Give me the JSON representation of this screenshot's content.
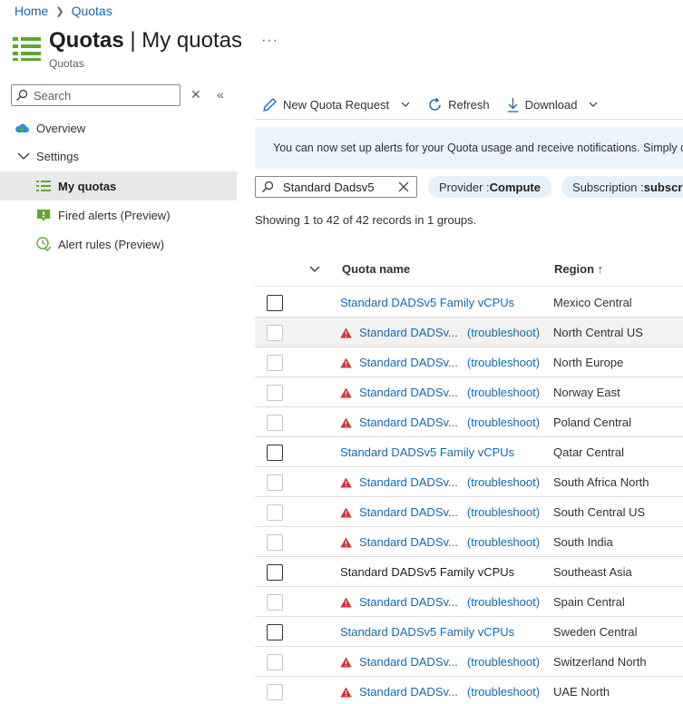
{
  "breadcrumb": {
    "home": "Home",
    "current": "Quotas"
  },
  "header": {
    "title_bold": "Quotas",
    "title_rest": " | My quotas",
    "subtitle": "Quotas",
    "more": "···"
  },
  "sidebar": {
    "search_placeholder": "Search",
    "items": [
      {
        "label": "Overview",
        "icon": "cloud-icon"
      },
      {
        "label": "Settings",
        "icon": "chevron-down-icon"
      },
      {
        "label": "My quotas",
        "icon": "list-icon",
        "selected": true
      },
      {
        "label": "Fired alerts (Preview)",
        "icon": "alert-book-icon"
      },
      {
        "label": "Alert rules (Preview)",
        "icon": "clock-check-icon"
      }
    ]
  },
  "toolbar": {
    "new_request": "New Quota Request",
    "refresh": "Refresh",
    "download": "Download"
  },
  "info_bar": {
    "text": "You can now set up alerts for your Quota usage and receive notifications. Simply cl"
  },
  "filter": {
    "search_value": "Standard Dadsv5",
    "provider_key": "Provider : ",
    "provider_value": "Compute",
    "subscription_key": "Subscription : ",
    "subscription_value": "subscri"
  },
  "records_text": "Showing 1 to 42 of 42 records in 1 groups.",
  "table": {
    "col_quota": "Quota name",
    "col_region": "Region ↑",
    "rows": [
      {
        "name": "Standard DADSv5 Family vCPUs",
        "warn": false,
        "link": true,
        "region": "Mexico Central",
        "hl": false
      },
      {
        "name": "Standard DADSv...",
        "warn": true,
        "link": true,
        "troubleshoot": "(troubleshoot)",
        "region": "North Central US",
        "hl": true
      },
      {
        "name": "Standard DADSv...",
        "warn": true,
        "link": true,
        "troubleshoot": "(troubleshoot)",
        "region": "North Europe",
        "hl": false
      },
      {
        "name": "Standard DADSv...",
        "warn": true,
        "link": true,
        "troubleshoot": "(troubleshoot)",
        "region": "Norway East",
        "hl": false
      },
      {
        "name": "Standard DADSv...",
        "warn": true,
        "link": true,
        "troubleshoot": "(troubleshoot)",
        "region": "Poland Central",
        "hl": false
      },
      {
        "name": "Standard DADSv5 Family vCPUs",
        "warn": false,
        "link": true,
        "region": "Qatar Central",
        "hl": false
      },
      {
        "name": "Standard DADSv...",
        "warn": true,
        "link": true,
        "troubleshoot": "(troubleshoot)",
        "region": "South Africa North",
        "hl": false
      },
      {
        "name": "Standard DADSv...",
        "warn": true,
        "link": true,
        "troubleshoot": "(troubleshoot)",
        "region": "South Central US",
        "hl": false
      },
      {
        "name": "Standard DADSv...",
        "warn": true,
        "link": true,
        "troubleshoot": "(troubleshoot)",
        "region": "South India",
        "hl": false
      },
      {
        "name": "Standard DADSv5 Family vCPUs",
        "warn": false,
        "link": false,
        "region": "Southeast Asia",
        "hl": false
      },
      {
        "name": "Standard DADSv...",
        "warn": true,
        "link": true,
        "troubleshoot": "(troubleshoot)",
        "region": "Spain Central",
        "hl": false
      },
      {
        "name": "Standard DADSv5 Family vCPUs",
        "warn": false,
        "link": true,
        "region": "Sweden Central",
        "hl": false
      },
      {
        "name": "Standard DADSv...",
        "warn": true,
        "link": true,
        "troubleshoot": "(troubleshoot)",
        "region": "Switzerland North",
        "hl": false
      },
      {
        "name": "Standard DADSv...",
        "warn": true,
        "link": true,
        "troubleshoot": "(troubleshoot)",
        "region": "UAE North",
        "hl": false
      }
    ]
  },
  "colors": {
    "link": "#0f6cbd",
    "warning": "#d13438",
    "info_bg": "#ebf3fc",
    "pill_bg": "#e6f0fb",
    "selected_bg": "#e8e8e8",
    "brand_green": "#5ea832"
  }
}
